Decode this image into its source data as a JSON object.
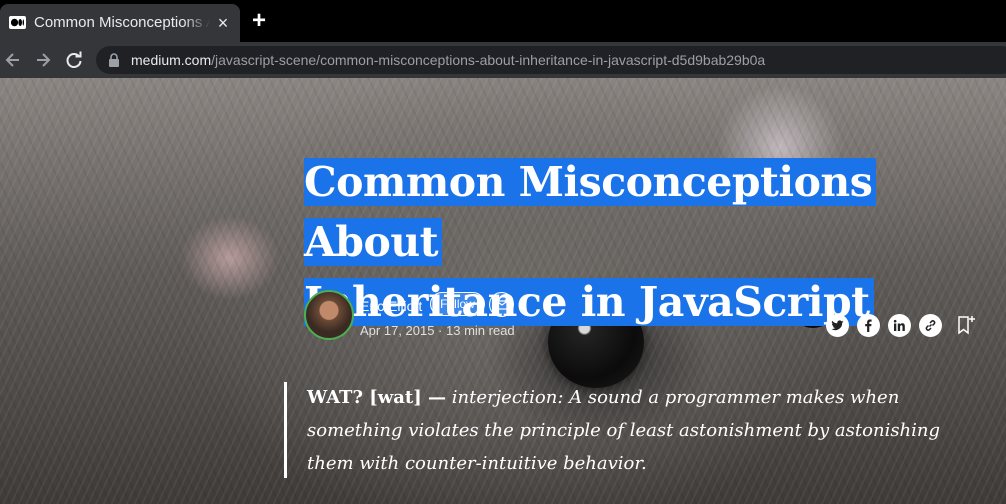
{
  "browser": {
    "tab_title": "Common Misconceptions About Inheritance in JavaScript",
    "tab_close": "×",
    "new_tab": "+",
    "url_domain": "medium.com",
    "url_path": "/javascript-scene/common-misconceptions-about-inheritance-in-javascript-d5d9bab29b0a"
  },
  "article": {
    "title_line1": "Common Misconceptions About",
    "title_line2": "Inheritance in JavaScript",
    "author": "Eric Elliott",
    "follow_label": "Follow",
    "meta": "Apr 17, 2015 · 13 min read",
    "quote_term": "WAT? [wat] —",
    "quote_text": "interjection: A sound a programmer makes when something violates the principle of least astonishment by astonishing them with counter-intuitive behavior."
  },
  "colors": {
    "selection": "#1a73e8",
    "tab_bg": "#35363a",
    "omnibox_bg": "#202124",
    "avatar_ring": "#4caf50"
  },
  "icons": [
    "medium-logo-icon",
    "close-icon",
    "plus-icon",
    "back-arrow-icon",
    "forward-arrow-icon",
    "reload-icon",
    "lock-icon",
    "mail-icon",
    "twitter-icon",
    "facebook-icon",
    "linkedin-icon",
    "link-icon",
    "bookmark-icon"
  ]
}
